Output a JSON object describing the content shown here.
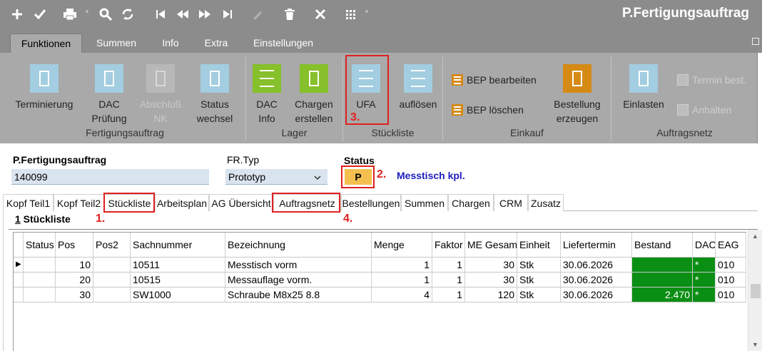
{
  "app": {
    "title": "P.Fertigungsauftrag"
  },
  "toolbar": {
    "icons": [
      "add-icon",
      "check-icon",
      "print-icon",
      "search-icon",
      "refresh-icon",
      "first-icon",
      "prev-icon",
      "next-icon",
      "last-icon",
      "edit-icon",
      "delete-icon",
      "close-icon",
      "grid-icon"
    ]
  },
  "menu": {
    "tabs": [
      "Funktionen",
      "Summen",
      "Info",
      "Extra",
      "Einstellungen"
    ],
    "active": "Funktionen"
  },
  "ribbon": {
    "groups": [
      {
        "label": "Fertigungsauftrag",
        "buttons": [
          {
            "label": "Terminierung",
            "line2": ""
          },
          {
            "label": "DAC",
            "line2": "Prüfung"
          },
          {
            "label": "Abschluß",
            "line2": "NK"
          },
          {
            "label": "Status",
            "line2": "wechsel"
          }
        ]
      },
      {
        "label": "Lager",
        "buttons": [
          {
            "label": "DAC",
            "line2": "Info"
          },
          {
            "label": "Chargen",
            "line2": "erstellen"
          }
        ]
      },
      {
        "label": "Stückliste",
        "buttons": [
          {
            "label": "UFA",
            "line2": ""
          },
          {
            "label": "auflösen",
            "line2": ""
          }
        ]
      },
      {
        "label": "Einkauf",
        "buttons": [
          {
            "label": "BEP bearbeiten"
          },
          {
            "label": "BEP löschen"
          },
          {
            "label": "Bestellung",
            "line2": "erzeugen"
          }
        ]
      },
      {
        "label": "Auftragsnetz",
        "buttons": [
          {
            "label": "Einlasten"
          },
          {
            "label": "Termin best."
          },
          {
            "label": "Anhalten"
          }
        ]
      }
    ]
  },
  "form": {
    "order_label": "P.Fertigungsauftrag",
    "order_value": "140099",
    "type_label": "FR.Typ",
    "type_value": "Prototyp",
    "status_label": "Status",
    "status_value": "P",
    "status_text": "Messtisch kpl."
  },
  "annotations": {
    "m1": "1.",
    "m2": "2.",
    "m3": "3.",
    "m4": "4."
  },
  "tabs": [
    "Kopf Teil1",
    "Kopf Teil2",
    "Stückliste",
    "Arbeitsplan",
    "AG Übersicht",
    "Auftragsnetz",
    "Bestellungen",
    "Summen",
    "Chargen",
    "CRM",
    "Zusatz"
  ],
  "subpanel": {
    "number": "1",
    "title": " Stückliste"
  },
  "table": {
    "columns": [
      "Status",
      "Pos",
      "Pos2",
      "Sachnummer",
      "Bezeichnung",
      "Menge",
      "Faktor",
      "ME Gesamt",
      "Einheit",
      "Liefertermin",
      "Bestand",
      "DAC",
      "EAG"
    ],
    "rows": [
      {
        "marker": "▶",
        "status": "",
        "pos": "10",
        "pos2": "",
        "sachnummer": "10511",
        "bezeichnung": "Messtisch vorm",
        "menge": "1",
        "faktor": "1",
        "me_gesamt": "30",
        "einheit": "Stk",
        "liefertermin": "30.06.2026",
        "bestand": "",
        "dac": "*",
        "eag": "010"
      },
      {
        "marker": "",
        "status": "",
        "pos": "20",
        "pos2": "",
        "sachnummer": "10515",
        "bezeichnung": "Messauflage vorm.",
        "menge": "1",
        "faktor": "1",
        "me_gesamt": "30",
        "einheit": "Stk",
        "liefertermin": "30.06.2026",
        "bestand": "",
        "dac": "*",
        "eag": "010"
      },
      {
        "marker": "",
        "status": "",
        "pos": "30",
        "pos2": "",
        "sachnummer": "SW1000",
        "bezeichnung": "Schraube M8x25 8.8",
        "menge": "4",
        "faktor": "1",
        "me_gesamt": "120",
        "einheit": "Stk",
        "liefertermin": "30.06.2026",
        "bestand": "2.470",
        "dac": "*",
        "eag": "010"
      }
    ]
  },
  "colors": {
    "accent_green": "#0b8e14",
    "mark_red": "#e02020",
    "status_yellow": "#f3bf4e",
    "status_text_blue": "#2020c0"
  }
}
